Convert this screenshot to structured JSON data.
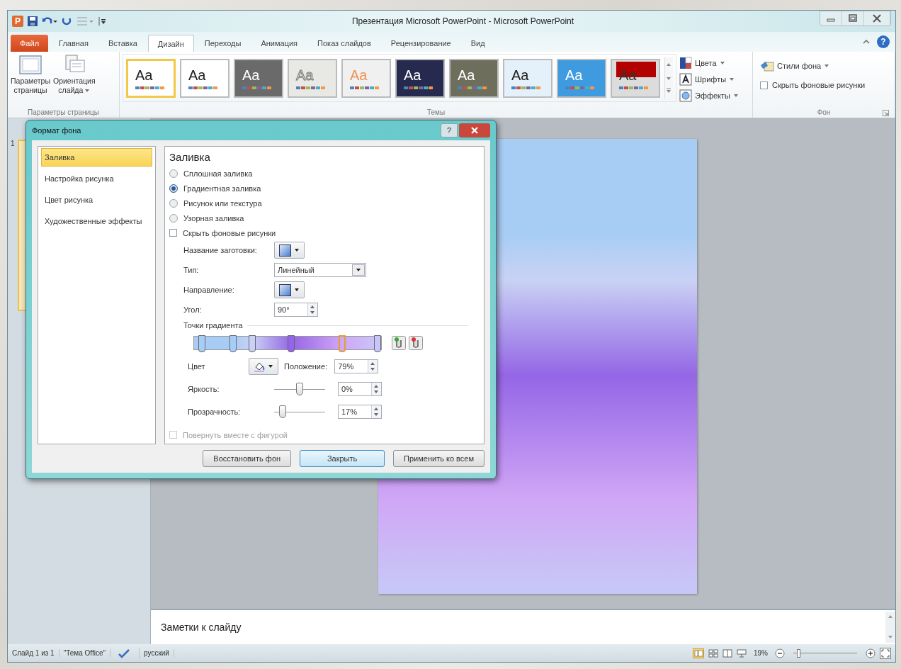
{
  "window": {
    "title": "Презентация Microsoft PowerPoint - Microsoft PowerPoint",
    "app_icon": "P",
    "help": "?"
  },
  "tabs": [
    {
      "label": "Файл",
      "kind": "file",
      "selected": false
    },
    {
      "label": "Главная",
      "kind": "tab",
      "selected": false
    },
    {
      "label": "Вставка",
      "kind": "tab",
      "selected": false
    },
    {
      "label": "Дизайн",
      "kind": "tab",
      "selected": true
    },
    {
      "label": "Переходы",
      "kind": "tab",
      "selected": false
    },
    {
      "label": "Анимация",
      "kind": "tab",
      "selected": false
    },
    {
      "label": "Показ слайдов",
      "kind": "tab",
      "selected": false
    },
    {
      "label": "Рецензирование",
      "kind": "tab",
      "selected": false
    },
    {
      "label": "Вид",
      "kind": "tab",
      "selected": false
    }
  ],
  "ribbon": {
    "page_group": {
      "label": "Параметры страницы",
      "buttons": [
        {
          "kind": "page",
          "lines": [
            "Параметры",
            "страницы"
          ]
        },
        {
          "kind": "orientation",
          "lines": [
            "Ориентация",
            "слайда"
          ]
        }
      ]
    },
    "themes_group": {
      "label": "Темы",
      "themes": [
        {
          "label": "Aa",
          "color": "#ffffff",
          "kind": "dark",
          "selected": true
        },
        {
          "label": "Aa",
          "color": "#ffffff",
          "kind": "dark",
          "selected": false
        },
        {
          "label": "Aa",
          "color": "#6a6a6a",
          "kind": "light",
          "selected": false
        },
        {
          "label": "Aa",
          "color": "#e8e8e4",
          "kind": "outline",
          "selected": false
        },
        {
          "label": "Aa",
          "color": "#f0f0f0",
          "kind": "orange",
          "selected": false
        },
        {
          "label": "Aa",
          "color": "#252a4e",
          "kind": "light",
          "selected": false
        },
        {
          "label": "Aa",
          "color": "#6e6e5c",
          "kind": "light",
          "selected": false
        },
        {
          "label": "Aa",
          "color": "#e4f0fa",
          "kind": "dark",
          "selected": false
        },
        {
          "label": "Aa",
          "color": "#3f9be0",
          "kind": "light",
          "selected": false
        },
        {
          "label": "Aa",
          "color": "#dcdcdc",
          "kind": "red-band",
          "selected": false
        }
      ],
      "options": [
        {
          "label": "Цвета",
          "kind": "colors"
        },
        {
          "label": "Шрифты",
          "kind": "fonts"
        },
        {
          "label": "Эффекты",
          "kind": "effects"
        }
      ]
    },
    "background_group": {
      "label": "Фон",
      "styles_button": "Стили фона",
      "hide_graphics": {
        "label": "Скрыть фоновые рисунки",
        "checked": false
      }
    }
  },
  "slides_panel": {
    "slide_number": "1"
  },
  "notes": {
    "placeholder": "Заметки к слайду"
  },
  "dialog": {
    "title": "Формат фона",
    "help": "?",
    "sidebar": [
      {
        "label": "Заливка",
        "selected": true
      },
      {
        "label": "Настройка рисунка",
        "selected": false
      },
      {
        "label": "Цвет рисунка",
        "selected": false
      },
      {
        "label": "Художественные эффекты",
        "selected": false
      }
    ],
    "heading": "Заливка",
    "fill_options": [
      {
        "label": "Сплошная заливка",
        "selected": false
      },
      {
        "label": "Градиентная заливка",
        "selected": true
      },
      {
        "label": "Рисунок или текстура",
        "selected": false
      },
      {
        "label": "Узорная заливка",
        "selected": false
      }
    ],
    "hide_graphics": {
      "label": "Скрыть фоновые рисунки",
      "checked": false
    },
    "preset_label": "Название заготовки:",
    "type": {
      "label": "Тип:",
      "value": "Линейный"
    },
    "direction_label": "Направление:",
    "angle": {
      "label": "Угол:",
      "value": "90°"
    },
    "stops_label": "Точки градиента",
    "stops": [
      {
        "level": 0.04,
        "color": "#a8cdf5",
        "selected": false
      },
      {
        "level": 0.21,
        "color": "#a8cdf5",
        "selected": false
      },
      {
        "level": 0.31,
        "color": "#c9d2f4",
        "selected": false
      },
      {
        "level": 0.52,
        "color": "#9466e6",
        "selected": false
      },
      {
        "level": 0.79,
        "color": "#d0a6f6",
        "selected": true
      },
      {
        "level": 0.98,
        "color": "#c8c6f7",
        "selected": false
      }
    ],
    "color_label": "Цвет",
    "position": {
      "label": "Положение:",
      "value": "79%"
    },
    "brightness": {
      "label": "Яркость:",
      "level": 0.5,
      "value": "0%"
    },
    "transparency": {
      "label": "Прозрачность:",
      "level": 0.17,
      "value": "17%"
    },
    "rotate": {
      "label": "Повернуть вместе с фигурой",
      "checked": false,
      "disabled": true
    },
    "buttons": [
      {
        "label": "Восстановить фон",
        "kind": "normal"
      },
      {
        "label": "Закрыть",
        "kind": "default"
      },
      {
        "label": "Применить ко всем",
        "kind": "normal"
      }
    ]
  },
  "status_bar": {
    "slide": "Слайд 1 из 1",
    "theme": "\"Тема Office\"",
    "language": "русский",
    "zoom": "19%",
    "zoom_slider": {
      "level": 0.08
    }
  }
}
